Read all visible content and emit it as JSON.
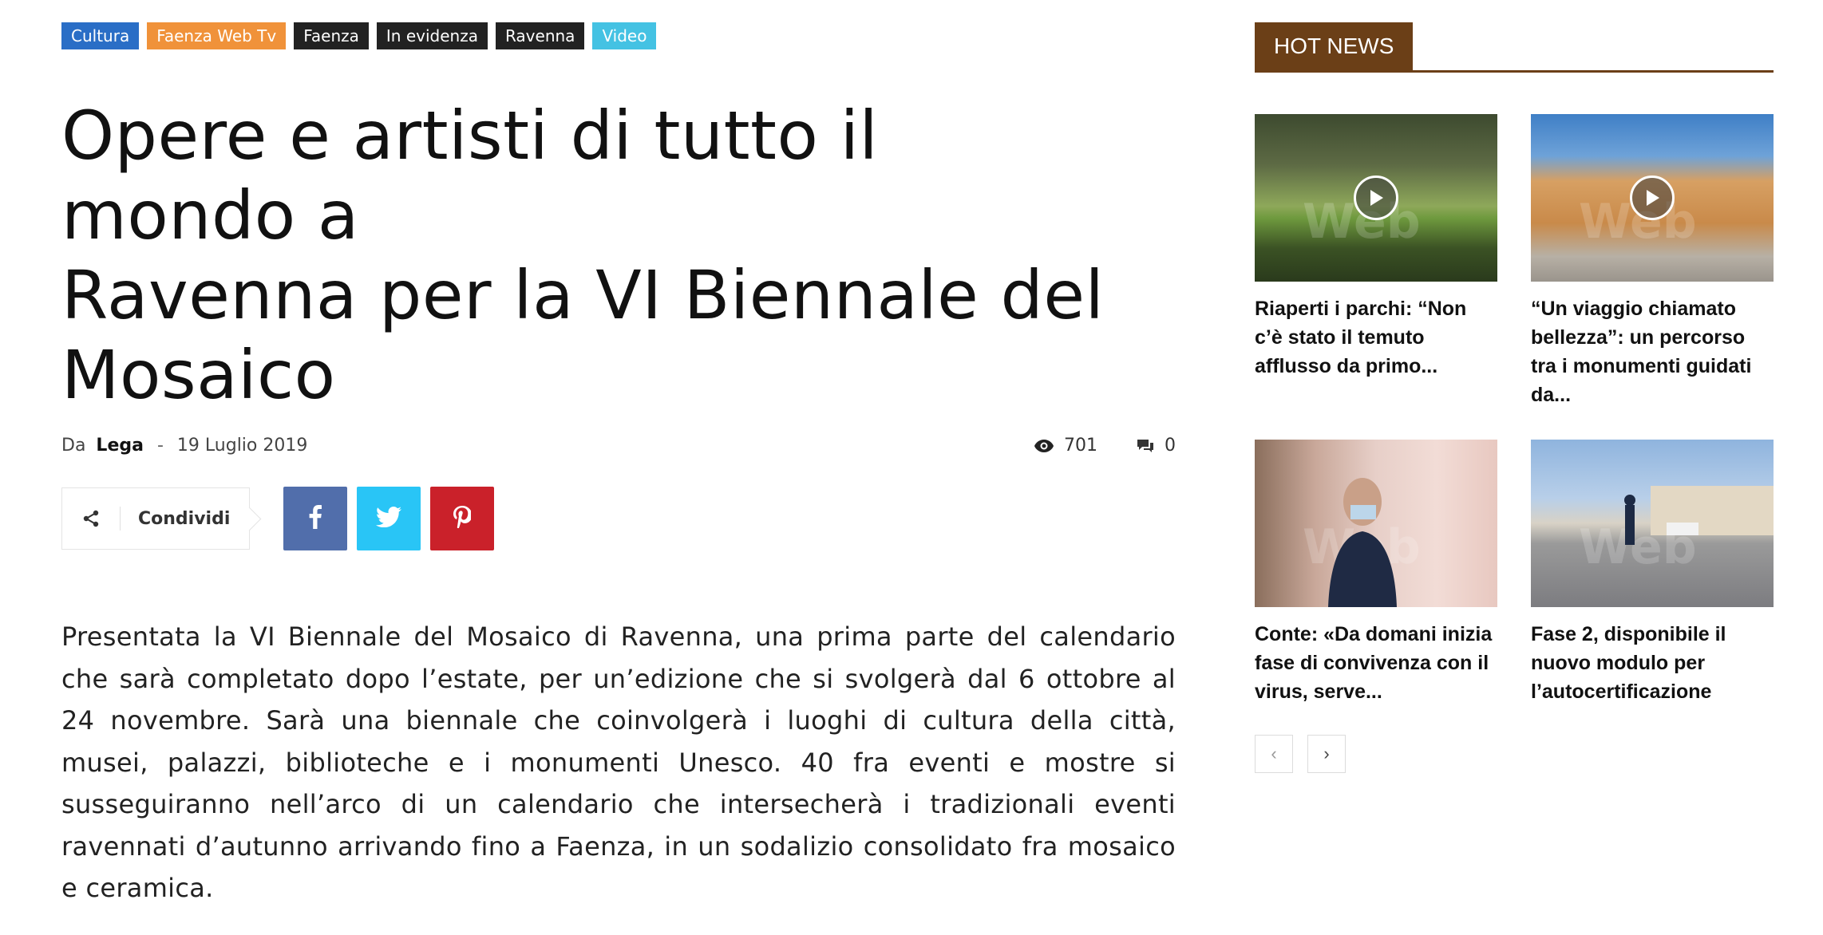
{
  "categories": [
    {
      "label": "Cultura",
      "color": "#2a6ec6"
    },
    {
      "label": "Faenza Web Tv",
      "color": "#f0923a"
    },
    {
      "label": "Faenza",
      "color": "#222222"
    },
    {
      "label": "In evidenza",
      "color": "#222222"
    },
    {
      "label": "Ravenna",
      "color": "#222222"
    },
    {
      "label": "Video",
      "color": "#44c2e3"
    }
  ],
  "article": {
    "title_lines": [
      "Opere e artisti di tutto il mondo a",
      "Ravenna per la VI Biennale del",
      "Mosaico"
    ],
    "by_prefix": "Da",
    "author": "Lega",
    "separator": "-",
    "date": "19 Luglio 2019",
    "views": "701",
    "comments": "0",
    "share_label": "Condividi",
    "social_colors": {
      "facebook": "#516eab",
      "twitter": "#29c5f6",
      "pinterest": "#ca212a"
    },
    "body": "Presentata la VI Biennale del Mosaico di Ravenna, una prima parte del calendario che sarà completato dopo l’estate, per un’edizione che si svolgerà dal 6 ottobre al 24 novembre. Sarà una biennale che coinvolgerà i luoghi di cultura della città, musei, palazzi, biblioteche e i monumenti Unesco. 40 fra eventi e mostre si susseguiranno nell’arco di un calendario che intersecherà i tradizionali eventi ravennati d’autunno arrivando fino a Faenza, in un sodalizio consolidato fra mosaico e ceramica."
  },
  "sidebar": {
    "block_title": "HOT NEWS",
    "accent": "#6b3f17",
    "cards": [
      {
        "title": "Riaperti i parchi: “Non c’è stato il temuto afflusso da primo...",
        "video": true
      },
      {
        "title": "“Un viaggio chiamato bellezza”: un percorso tra i monumenti guidati da...",
        "video": true
      },
      {
        "title": "Conte: «Da domani inizia fase di convivenza con il virus, serve...",
        "video": false
      },
      {
        "title": "Fase 2, disponibile il nuovo modulo per l’autocertificazione",
        "video": false
      }
    ],
    "watermark": "Web",
    "pager_prev": "‹",
    "pager_next": "›"
  }
}
